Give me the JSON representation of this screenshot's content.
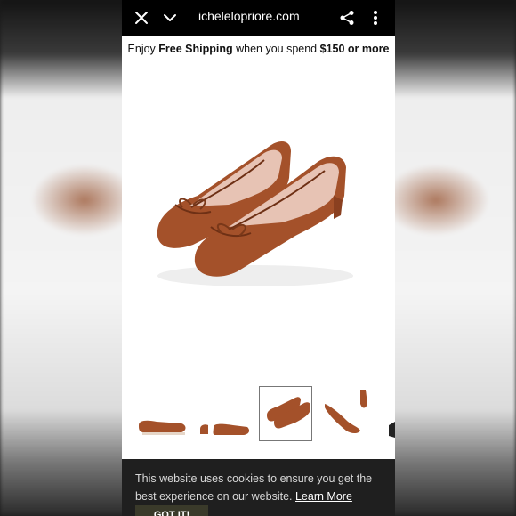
{
  "browser": {
    "url": "ichelelopriore.com"
  },
  "promo": {
    "prefix": "Enjoy ",
    "bold1": "Free Shipping",
    "middle": " when you spend ",
    "bold2": "$150 or more"
  },
  "product": {
    "image_icon": "ballet-flats-image",
    "thumbnails_count_visible": 5,
    "selected_thumbnail": 3
  },
  "cookie": {
    "text": "This website uses cookies to ensure you get the best experience on our website.",
    "link": "Learn More",
    "button": "GOT IT!"
  },
  "colors": {
    "leather": "#a4512a",
    "topbar": "#000000",
    "banner": "#1f1f1f"
  }
}
